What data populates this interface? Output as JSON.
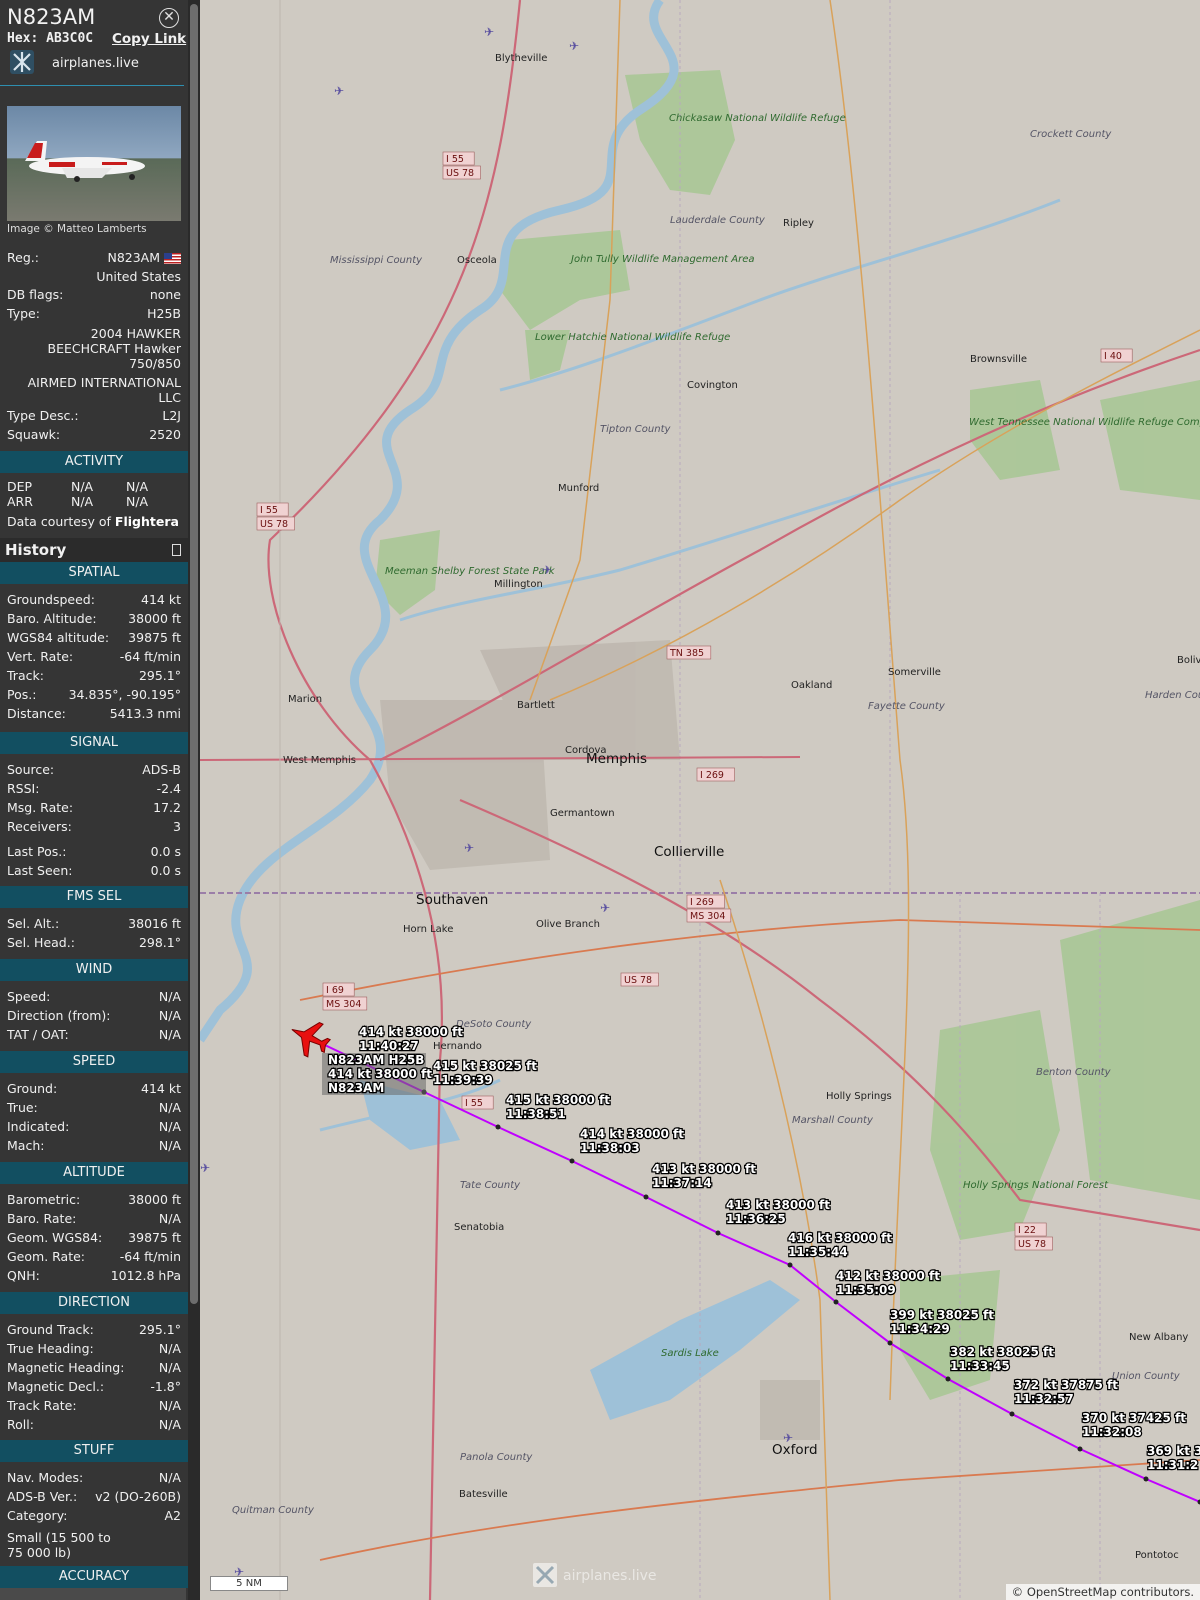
{
  "header": {
    "callsign": "N823AM",
    "hex_label": "Hex:",
    "hex": "AB3C0C",
    "copy_link": "Copy Link",
    "source": "airplanes.live",
    "close_icon": "close-icon"
  },
  "photo": {
    "credit": "Image © Matteo Lamberts"
  },
  "info": {
    "reg_label": "Reg.:",
    "reg": "N823AM",
    "country": "United States",
    "dbflags_label": "DB flags:",
    "dbflags": "none",
    "type_label": "Type:",
    "type": "H25B",
    "model_l1": "2004 HAWKER",
    "model_l2": "BEECHCRAFT Hawker",
    "model_l3": "750/850",
    "owner_l1": "AIRMED INTERNATIONAL",
    "owner_l2": "LLC",
    "typedesc_label": "Type Desc.:",
    "typedesc": "L2J",
    "squawk_label": "Squawk:",
    "squawk": "2520"
  },
  "activity": {
    "title": "ACTIVITY",
    "dep": "DEP",
    "arr": "ARR",
    "na": "N/A",
    "courtesy": "Data courtesy of ",
    "provider": "Flightera"
  },
  "history": {
    "title": "History"
  },
  "spatial": {
    "title": "SPATIAL",
    "rows": [
      {
        "label": "Groundspeed:",
        "value": "414 kt"
      },
      {
        "label": "Baro. Altitude:",
        "value": "38000 ft"
      },
      {
        "label": "WGS84 altitude:",
        "value": "39875 ft"
      },
      {
        "label": "Vert. Rate:",
        "value": "-64 ft/min"
      },
      {
        "label": "Track:",
        "value": "295.1°"
      },
      {
        "label": "Pos.:",
        "value": "34.835°, -90.195°"
      },
      {
        "label": "Distance:",
        "value": "5413.3 nmi"
      }
    ]
  },
  "signal": {
    "title": "SIGNAL",
    "rows": [
      {
        "label": "Source:",
        "value": "ADS-B"
      },
      {
        "label": "RSSI:",
        "value": "-2.4"
      },
      {
        "label": "Msg. Rate:",
        "value": "17.2"
      },
      {
        "label": "Receivers:",
        "value": "3"
      },
      {
        "label": "Last Pos.:",
        "value": "0.0 s"
      },
      {
        "label": "Last Seen:",
        "value": "0.0 s"
      }
    ]
  },
  "fms": {
    "title": "FMS SEL",
    "rows": [
      {
        "label": "Sel. Alt.:",
        "value": "38016 ft"
      },
      {
        "label": "Sel. Head.:",
        "value": "298.1°"
      }
    ]
  },
  "wind": {
    "title": "WIND",
    "rows": [
      {
        "label": "Speed:",
        "value": "N/A"
      },
      {
        "label": "Direction (from):",
        "value": "N/A"
      },
      {
        "label": "TAT / OAT:",
        "value": "N/A"
      }
    ]
  },
  "speed": {
    "title": "SPEED",
    "rows": [
      {
        "label": "Ground:",
        "value": "414 kt"
      },
      {
        "label": "True:",
        "value": "N/A"
      },
      {
        "label": "Indicated:",
        "value": "N/A"
      },
      {
        "label": "Mach:",
        "value": "N/A"
      }
    ]
  },
  "altitude": {
    "title": "ALTITUDE",
    "rows": [
      {
        "label": "Barometric:",
        "value": "38000 ft"
      },
      {
        "label": "Baro. Rate:",
        "value": "N/A"
      },
      {
        "label": "Geom. WGS84:",
        "value": "39875 ft"
      },
      {
        "label": "Geom. Rate:",
        "value": "-64 ft/min"
      },
      {
        "label": "QNH:",
        "value": "1012.8 hPa"
      }
    ]
  },
  "direction": {
    "title": "DIRECTION",
    "rows": [
      {
        "label": "Ground Track:",
        "value": "295.1°"
      },
      {
        "label": "True Heading:",
        "value": "N/A"
      },
      {
        "label": "Magnetic Heading:",
        "value": "N/A"
      },
      {
        "label": "Magnetic Decl.:",
        "value": "-1.8°"
      },
      {
        "label": "Track Rate:",
        "value": "N/A"
      },
      {
        "label": "Roll:",
        "value": "N/A"
      }
    ]
  },
  "stuff": {
    "title": "STUFF",
    "rows": [
      {
        "label": "Nav. Modes:",
        "value": "N/A"
      },
      {
        "label": "ADS-B Ver.:",
        "value": "v2 (DO-260B)"
      },
      {
        "label": "Category:",
        "value": "A2"
      }
    ],
    "cat_l1": "Small (15 500 to",
    "cat_l2": "75 000 lb)"
  },
  "accuracy": {
    "title": "ACCURACY"
  },
  "map": {
    "scale": "5 NM",
    "attribution": "© OpenStreetMap contributors.",
    "watermark": "airplanes.live",
    "track_color": "#c000ff",
    "aircraft_color": "#e81010",
    "aircraft_labels": [
      "N823AM H25B",
      "414 kt  38000 ft",
      "N823AM"
    ],
    "track_points": [
      {
        "speed_alt": "414 kt  38000 ft",
        "time": "11:40:27"
      },
      {
        "speed_alt": "415 kt  38025 ft",
        "time": "11:39:39"
      },
      {
        "speed_alt": "415 kt  38000 ft",
        "time": "11:38:51"
      },
      {
        "speed_alt": "414 kt  38000 ft",
        "time": "11:38:03"
      },
      {
        "speed_alt": "413 kt  38000 ft",
        "time": "11:37:14"
      },
      {
        "speed_alt": "413 kt  38000 ft",
        "time": "11:36:25"
      },
      {
        "speed_alt": "416 kt  38000 ft",
        "time": "11:35:44"
      },
      {
        "speed_alt": "412 kt  38000 ft",
        "time": "11:35:09"
      },
      {
        "speed_alt": "399 kt  38025 ft",
        "time": "11:34:29"
      },
      {
        "speed_alt": "382 kt  38025 ft",
        "time": "11:33:45"
      },
      {
        "speed_alt": "372 kt  37875 ft",
        "time": "11:32:57"
      },
      {
        "speed_alt": "370 kt  37425 ft",
        "time": "11:32:08"
      },
      {
        "speed_alt": "369 kt  3",
        "time": "11:31:2"
      }
    ],
    "towns": [
      "Memphis",
      "Southaven",
      "Collierville",
      "Oxford",
      "Blytheville",
      "Osceola",
      "Ripley",
      "Covington",
      "Brownsville",
      "Munford",
      "Millington",
      "Bartlett",
      "Cordova",
      "Germantown",
      "Marion",
      "West Memphis",
      "Horn Lake",
      "Olive Branch",
      "Hernando",
      "Senatobia",
      "Batesville",
      "Holly Springs",
      "Oakland",
      "Somerville",
      "New Albany",
      "Pontotoc",
      "Boliva"
    ],
    "areas": [
      "Mississippi County",
      "Lauderdale County",
      "Tipton County",
      "Crockett County",
      "Fayette County",
      "DeSoto County",
      "Tate County",
      "Marshall County",
      "Benton County",
      "Union County",
      "Panola County",
      "Quitman County",
      "Harden Coun"
    ],
    "parks": [
      "Chickasaw National Wildlife Refuge",
      "John Tully Wildlife Management Area",
      "Lower Hatchie National Wildlife Refuge",
      "West Tennessee National Wildlife Refuge Complex",
      "Meeman Shelby Forest State Park",
      "Holly Springs National Forest",
      "Sardis Lake"
    ],
    "shields": [
      "I 55",
      "US 78",
      "I 55",
      "US 78",
      "TN 385",
      "I 269",
      "I 269",
      "MS 304",
      "US 78",
      "I 69",
      "MS 304",
      "I 55",
      "I 40",
      "I 22",
      "US 78"
    ]
  }
}
